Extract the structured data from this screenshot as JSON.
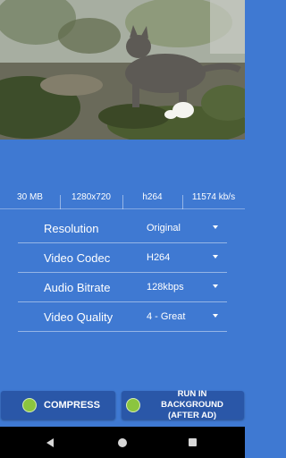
{
  "preview": {
    "icon": "video-preview-cat-in-garden"
  },
  "info": {
    "size": "30 MB",
    "resolution": "1280x720",
    "codec": "h264",
    "bitrate": "11574 kb/s"
  },
  "settings": [
    {
      "label": "Resolution",
      "value": "Original"
    },
    {
      "label": "Video Codec",
      "value": "H264"
    },
    {
      "label": "Audio Bitrate",
      "value": "128kbps"
    },
    {
      "label": "Video Quality",
      "value": "4 - Great"
    }
  ],
  "buttons": {
    "compress": "COMPRESS",
    "background_line1": "RUN IN BACKGROUND",
    "background_line2": "(AFTER AD)"
  },
  "colors": {
    "background": "#3f79d2",
    "button": "#2a57a8",
    "dot": "#8bc53f"
  }
}
